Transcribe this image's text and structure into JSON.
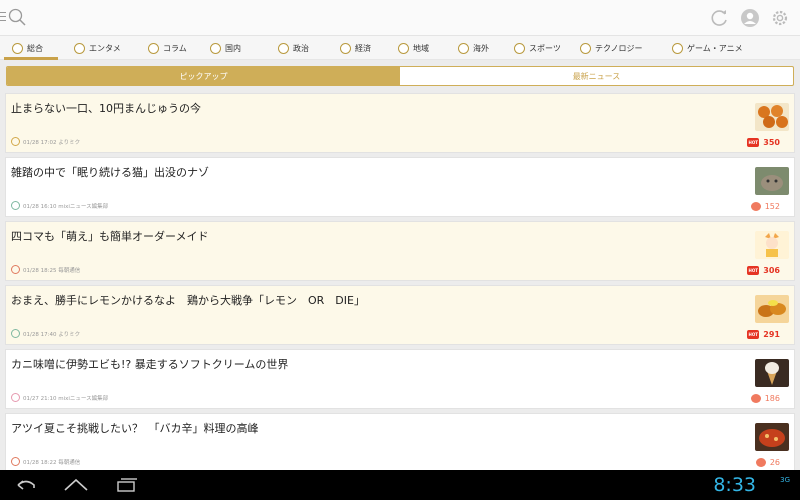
{
  "categories": [
    {
      "label": "総合",
      "icon": "home-icon",
      "active": true
    },
    {
      "label": "エンタメ",
      "icon": "entertainment-icon"
    },
    {
      "label": "コラム",
      "icon": "column-icon"
    },
    {
      "label": "国内",
      "icon": "domestic-icon"
    },
    {
      "label": "政治",
      "icon": "politics-icon"
    },
    {
      "label": "経済",
      "icon": "economy-icon"
    },
    {
      "label": "地域",
      "icon": "region-icon"
    },
    {
      "label": "海外",
      "icon": "globe-icon"
    },
    {
      "label": "スポーツ",
      "icon": "sports-icon"
    },
    {
      "label": "テクノロジー",
      "icon": "technology-icon"
    },
    {
      "label": "ゲーム・アニメ",
      "icon": "game-icon"
    }
  ],
  "segments": {
    "pickup": "ピックアップ",
    "latest": "最新ニュース"
  },
  "articles": [
    {
      "title": "止まらない一口、10円まんじゅうの今",
      "meta": "01/28 17:02 よりミク",
      "count": "350",
      "hot": true,
      "highlight": true
    },
    {
      "title": "雑踏の中で「眠り続ける猫」出没のナゾ",
      "meta": "01/28 16:10 mixiニュース編集部",
      "count": "152",
      "hot": false,
      "highlight": false
    },
    {
      "title": "四コマも「萌え」も簡単オーダーメイド",
      "meta": "01/28 18:25 毎朝通信",
      "count": "306",
      "hot": true,
      "highlight": true
    },
    {
      "title": "おまえ、勝手にレモンかけるなよ　鶏から大戦争「レモン　OR　DIE」",
      "meta": "01/28 17:40 よりミク",
      "count": "291",
      "hot": true,
      "highlight": true
    },
    {
      "title": "カニ味噌に伊勢エビも!? 暴走するソフトクリームの世界",
      "meta": "01/27 21:10 mixiニュース編集部",
      "count": "186",
      "hot": false,
      "highlight": false
    },
    {
      "title": "アツイ夏こそ挑戦したい？　「バカ辛」料理の高峰",
      "meta": "01/28 18:22 毎朝通信",
      "count": "26",
      "hot": false,
      "highlight": false
    }
  ],
  "status": {
    "time": "8:33",
    "signal": "3G"
  },
  "colors": {
    "accent": "#c9a24a",
    "hot": "#e53423",
    "comment": "#f07a5f",
    "clock": "#33b5e5"
  }
}
